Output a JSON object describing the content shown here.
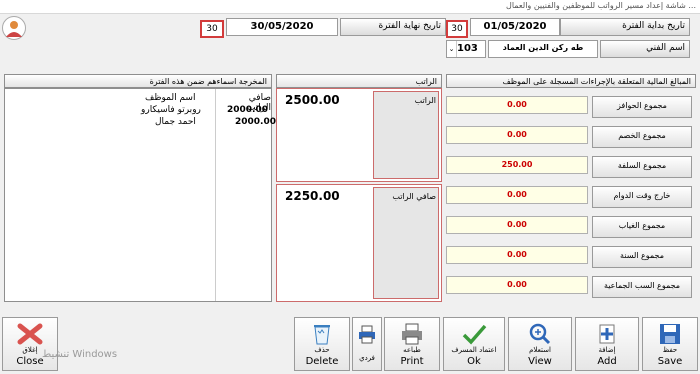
{
  "window": {
    "title": "... شاشة إعداد مسير الرواتب للموظفين والفنيين والعمال"
  },
  "period": {
    "start_label": "تاريخ بداية الفترة",
    "start_value": "01/05/2020",
    "start_days": "30",
    "end_label": "تاريخ نهاية الفترة",
    "end_value": "30/05/2020",
    "end_days": "30"
  },
  "technician": {
    "label": "اسم الفني",
    "name": "طه ركن الدين العماد",
    "code": "103"
  },
  "headers": {
    "period_salaries": "المخرجة اسماءهم ضمن هذه الفترة",
    "salary": "الراتب",
    "amounts": "المبالغ المالية المتعلقة بالإجراءات المسجلة على الموظف"
  },
  "employees_table": {
    "columns": [
      "صافي الراتب",
      "اسم الموظف"
    ],
    "rows": [
      {
        "net": "2000.00",
        "name": "روبرتو فاسيكارو"
      },
      {
        "net": "2000.00",
        "name": "احمد جمال"
      }
    ]
  },
  "salary_boxes": {
    "salary_label": "الراتب",
    "salary_value": "2500.00",
    "net_label": "صافي الراتب",
    "net_value": "2250.00"
  },
  "summary": [
    {
      "label": "مجموع الحوافز",
      "value": "0.00"
    },
    {
      "label": "مجموع الخصم",
      "value": "0.00"
    },
    {
      "label": "مجموع السلفة",
      "value": "250.00"
    },
    {
      "label": "خارج وقت الدوام",
      "value": "0.00"
    },
    {
      "label": "مجموع الغياب",
      "value": "0.00"
    },
    {
      "label": "مجموع السنة",
      "value": "0.00"
    },
    {
      "label": "مجموع السب الجماعية",
      "value": "0.00"
    }
  ],
  "buttons": {
    "save": {
      "ar": "حفظ",
      "en": "Save"
    },
    "add": {
      "ar": "إضافة",
      "en": "Add"
    },
    "view": {
      "ar": "استعلام",
      "en": "View"
    },
    "ok": {
      "ar": "اعتماد المسرف",
      "en": "Ok"
    },
    "print": {
      "ar": "طباعه",
      "en": "Print"
    },
    "individual": {
      "ar": "فردي"
    },
    "delete": {
      "ar": "حذف",
      "en": "Delete"
    },
    "close": {
      "ar": "إغلاق",
      "en": "Close"
    }
  },
  "watermark": "تنشيط Windows"
}
